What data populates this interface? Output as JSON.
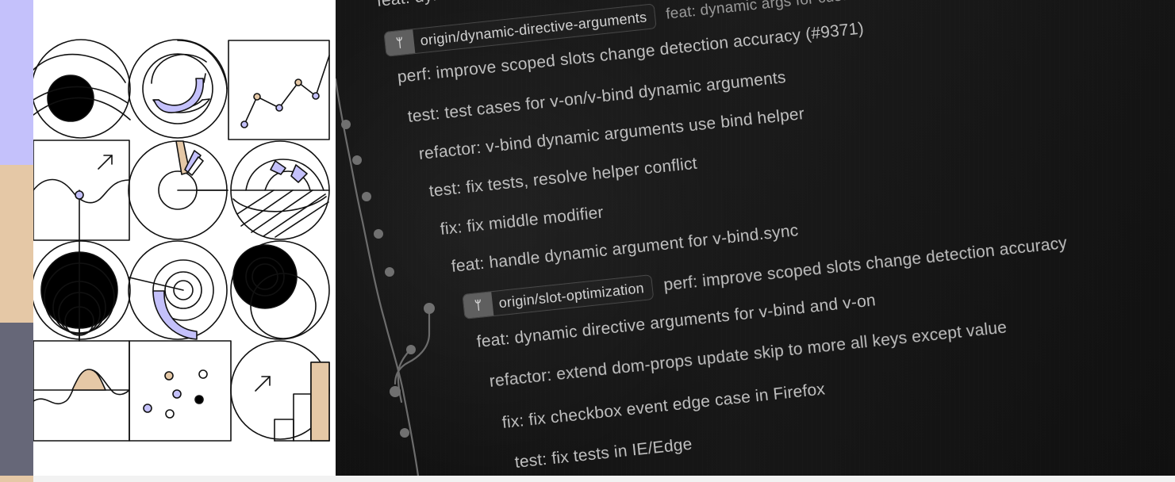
{
  "commits": [
    {
      "message": "feat: dynamic directive arguments for v-on, v-bind and custom directives"
    },
    {
      "branch": "origin/dynamic-directive-arguments",
      "message": "feat: dynamic args for custom directives"
    },
    {
      "message": "perf: improve scoped slots change detection accuracy (#9371)"
    },
    {
      "message": "test: test cases for v-on/v-bind dynamic arguments"
    },
    {
      "message": "refactor: v-bind dynamic arguments use bind helper"
    },
    {
      "message": "test: fix tests, resolve helper conflict"
    },
    {
      "message": "fix: fix middle modifier"
    },
    {
      "message": "feat: handle dynamic argument for v-bind.sync"
    },
    {
      "branch": "origin/slot-optimization",
      "message": "perf: improve scoped slots change detection accuracy"
    },
    {
      "message": "feat: dynamic directive arguments for v-bind and v-on"
    },
    {
      "message": "refactor: extend dom-props update skip to more all keys except value"
    },
    {
      "message": "fix: fix checkbox event edge case in Firefox"
    },
    {
      "message": "test: fix tests in IE/Edge"
    }
  ],
  "icons": {
    "branch": "branch-icon"
  },
  "colors": {
    "lavender": "#c4c1fb",
    "sand": "#e5c8a6",
    "slate": "#666778",
    "dark": "#121212",
    "text": "#bdbdbd"
  }
}
